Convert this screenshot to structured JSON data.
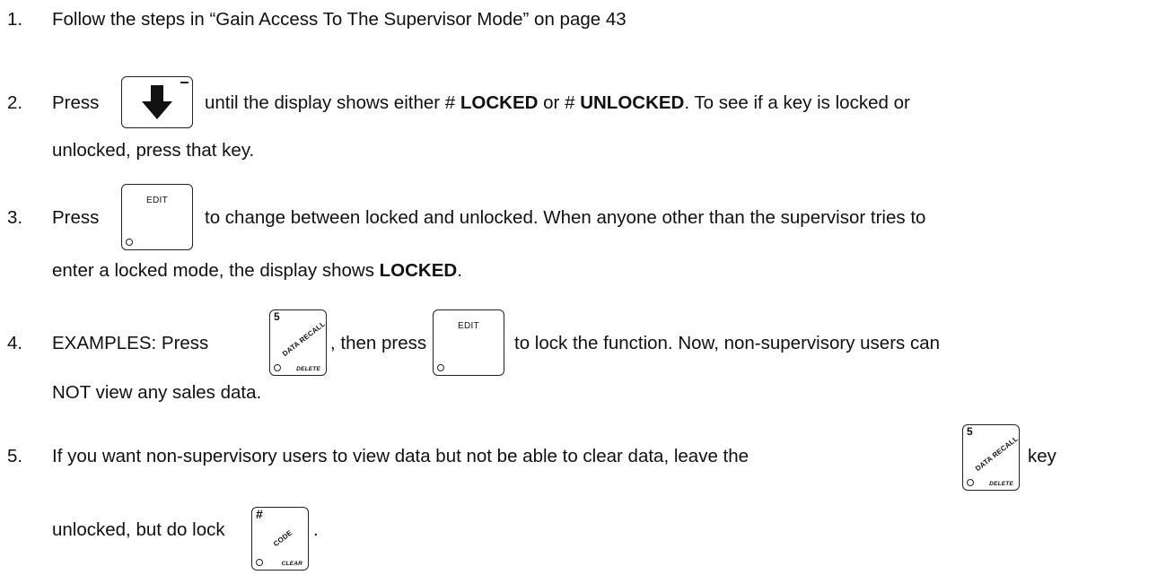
{
  "steps": [
    {
      "number": "1.",
      "text": "Follow the steps in “Gain Access To The Supervisor Mode” on page 43"
    },
    {
      "number": "2.",
      "press": "Press",
      "after_key": "until the display shows either #",
      "locked": "LOCKED",
      "or": "or #",
      "unlocked": "UNLOCKED",
      "tail": ".  To see if a key is locked or",
      "line2": "unlocked, press that key."
    },
    {
      "number": "3.",
      "press": "Press",
      "after_key": "to change between locked and unlocked.  When anyone other than the supervisor tries to",
      "line2_pre": "enter a locked mode, the display shows",
      "line2_bold": "LOCKED",
      "line2_post": "."
    },
    {
      "number": "4.",
      "press": "EXAMPLES:  Press",
      "then": ", then press",
      "after_key": "to lock the function.  Now, non-supervisory users can",
      "line2": "NOT view any sales data."
    },
    {
      "number": "5.",
      "text": "If you want non-supervisory users to view data but not be able to clear data, leave the",
      "after_key": "key",
      "line2_pre": "unlocked, but do lock",
      "line2_post": "."
    }
  ],
  "keys": {
    "edit_label": "EDIT",
    "data_recall": {
      "number": "5",
      "diagonal": "DATA RECALL",
      "sub": "DELETE"
    },
    "code": {
      "symbol": "#",
      "diagonal": "CODE",
      "sub": "CLEAR"
    },
    "down_arrow_icon": "down-arrow-icon"
  }
}
